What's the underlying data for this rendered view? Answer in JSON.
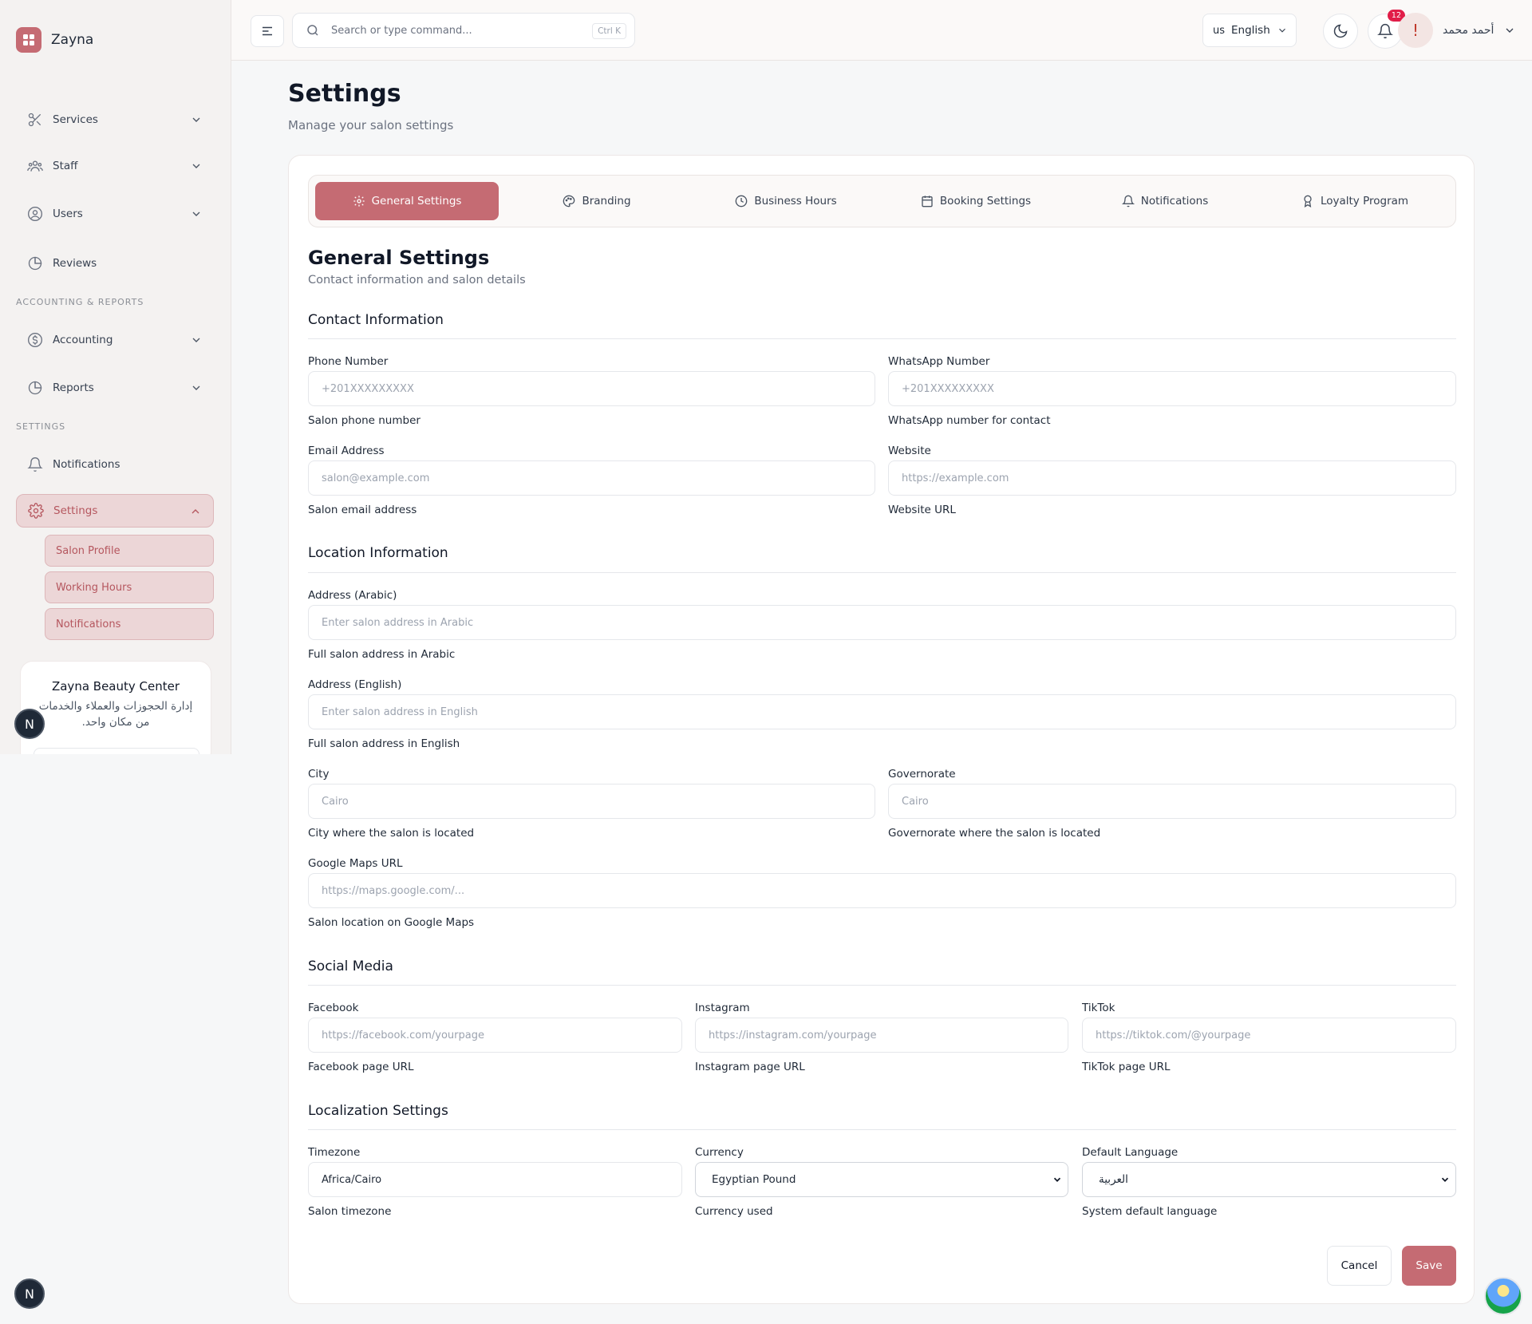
{
  "brand": {
    "name": "Zayna"
  },
  "sidebar": {
    "items": [
      {
        "label": "Services",
        "icon": "scissors-icon"
      },
      {
        "label": "Staff",
        "icon": "staff-icon"
      },
      {
        "label": "Users",
        "icon": "user-circle-icon"
      },
      {
        "label": "Reviews",
        "icon": "pie-chart-icon"
      },
      {
        "label": "Accounting",
        "icon": "dollar-icon"
      },
      {
        "label": "Reports",
        "icon": "pie-chart-icon"
      },
      {
        "label": "Notifications",
        "icon": "bell-icon"
      },
      {
        "label": "Settings",
        "icon": "gear-icon"
      }
    ],
    "sections": {
      "accounting": "ACCOUNTING & REPORTS",
      "settings": "SETTINGS"
    },
    "sub_items": [
      "Salon Profile",
      "Working Hours",
      "Notifications"
    ],
    "promo": {
      "title": "Zayna Beauty Center",
      "text": "إدارة الحجوزات والعملاء والخدمات من مكان واحد."
    },
    "n_badge": "N"
  },
  "topbar": {
    "search_placeholder": "Search or type command...",
    "shortcut": "Ctrl K",
    "language": {
      "flag": "us",
      "label": "English"
    },
    "notifications_count": "12",
    "user_name": "أحمد محمد",
    "avatar_glyph": "!"
  },
  "page": {
    "title": "Settings",
    "subtitle": "Manage your salon settings"
  },
  "tabs": [
    {
      "label": "General Settings",
      "icon": "gear-icon",
      "active": true
    },
    {
      "label": "Branding",
      "icon": "palette-icon"
    },
    {
      "label": "Business Hours",
      "icon": "clock-icon"
    },
    {
      "label": "Booking Settings",
      "icon": "calendar-icon"
    },
    {
      "label": "Notifications",
      "icon": "bell-icon"
    },
    {
      "label": "Loyalty Program",
      "icon": "award-icon"
    }
  ],
  "general": {
    "title": "General Settings",
    "subtitle": "Contact information and salon details",
    "contact": {
      "title": "Contact Information",
      "phone": {
        "label": "Phone Number",
        "placeholder": "+201XXXXXXXXX",
        "help": "Salon phone number"
      },
      "whatsapp": {
        "label": "WhatsApp Number",
        "placeholder": "+201XXXXXXXXX",
        "help": "WhatsApp number for contact"
      },
      "email": {
        "label": "Email Address",
        "placeholder": "salon@example.com",
        "help": "Salon email address"
      },
      "website": {
        "label": "Website",
        "placeholder": "https://example.com",
        "help": "Website URL"
      }
    },
    "location": {
      "title": "Location Information",
      "address_ar": {
        "label": "Address (Arabic)",
        "placeholder": "Enter salon address in Arabic",
        "help": "Full salon address in Arabic"
      },
      "address_en": {
        "label": "Address (English)",
        "placeholder": "Enter salon address in English",
        "help": "Full salon address in English"
      },
      "city": {
        "label": "City",
        "placeholder": "Cairo",
        "help": "City where the salon is located"
      },
      "governorate": {
        "label": "Governorate",
        "placeholder": "Cairo",
        "help": "Governorate where the salon is located"
      },
      "maps": {
        "label": "Google Maps URL",
        "placeholder": "https://maps.google.com/...",
        "help": "Salon location on Google Maps"
      }
    },
    "social": {
      "title": "Social Media",
      "facebook": {
        "label": "Facebook",
        "placeholder": "https://facebook.com/yourpage",
        "help": "Facebook page URL"
      },
      "instagram": {
        "label": "Instagram",
        "placeholder": "https://instagram.com/yourpage",
        "help": "Instagram page URL"
      },
      "tiktok": {
        "label": "TikTok",
        "placeholder": "https://tiktok.com/@yourpage",
        "help": "TikTok page URL"
      }
    },
    "localization": {
      "title": "Localization Settings",
      "timezone": {
        "label": "Timezone",
        "value": "Africa/Cairo",
        "help": "Salon timezone"
      },
      "currency": {
        "label": "Currency",
        "value": "Egyptian Pound",
        "help": "Currency used"
      },
      "language": {
        "label": "Default Language",
        "value": "العربية",
        "help": "System default language"
      }
    }
  },
  "actions": {
    "cancel": "Cancel",
    "save": "Save"
  },
  "colors": {
    "accent": "#c56b73",
    "accent_light": "#ecd6d7",
    "badge": "#e11d48"
  }
}
